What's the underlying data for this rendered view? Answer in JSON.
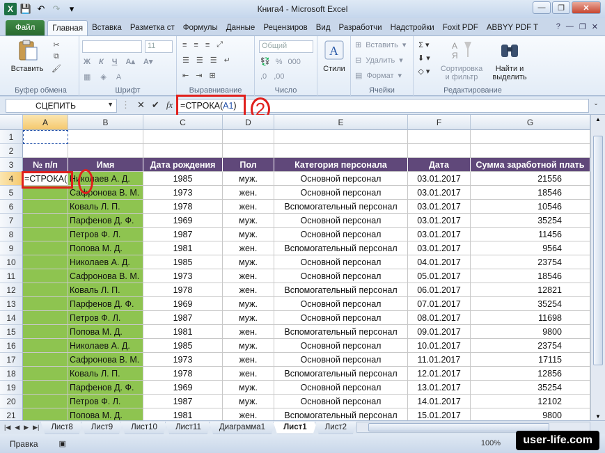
{
  "window": {
    "title": "Книга4  -  Microsoft Excel"
  },
  "tabs": [
    "Файл",
    "Главная",
    "Вставка",
    "Разметка ст",
    "Формулы",
    "Данные",
    "Рецензиров",
    "Вид",
    "Разработчи",
    "Надстройки",
    "Foxit PDF",
    "ABBYY PDF T"
  ],
  "ribbon": {
    "clipboard": {
      "paste": "Вставить",
      "label": "Буфер обмена"
    },
    "font": {
      "size": "11",
      "label": "Шрифт",
      "bold": "Ж",
      "italic": "К",
      "underline": "Ч"
    },
    "alignment": {
      "label": "Выравнивание"
    },
    "number": {
      "format": "Общий",
      "label": "Число"
    },
    "styles": {
      "label": "Стили"
    },
    "cells": {
      "insert": "Вставить",
      "delete": "Удалить",
      "format": "Формат",
      "label": "Ячейки"
    },
    "editing": {
      "sort": "Сортировка",
      "sort2": "и фильтр",
      "find": "Найти и",
      "find2": "выделить",
      "label": "Редактирование"
    }
  },
  "formula_bar": {
    "name_box": "СЦЕПИТЬ",
    "formula_prefix": "=СТРОКА(",
    "formula_ref": "A1",
    "formula_suffix": ")",
    "fx": "fx"
  },
  "annotation": {
    "number": "2"
  },
  "columns": [
    "A",
    "B",
    "C",
    "D",
    "E",
    "F",
    "G"
  ],
  "row_numbers": [
    "1",
    "2",
    "3",
    "4",
    "5",
    "6",
    "7",
    "8",
    "9",
    "10",
    "11",
    "12",
    "13",
    "14",
    "15",
    "16",
    "17",
    "18",
    "19",
    "20",
    "21"
  ],
  "table": {
    "headers": [
      "№ п/п",
      "Имя",
      "Дата рождения",
      "Пол",
      "Категория персонала",
      "Дата",
      "Сумма заработной плать"
    ],
    "editing_cell": "=СТРОКА(",
    "rows": [
      [
        "Николаев А. Д.",
        "1985",
        "муж.",
        "Основной персонал",
        "03.01.2017",
        "21556"
      ],
      [
        "Сафронова В. М.",
        "1973",
        "жен.",
        "Основной персонал",
        "03.01.2017",
        "18546"
      ],
      [
        "Коваль Л. П.",
        "1978",
        "жен.",
        "Вспомогательный персонал",
        "03.01.2017",
        "10546"
      ],
      [
        "Парфенов Д. Ф.",
        "1969",
        "муж.",
        "Основной персонал",
        "03.01.2017",
        "35254"
      ],
      [
        "Петров Ф. Л.",
        "1987",
        "муж.",
        "Основной персонал",
        "03.01.2017",
        "11456"
      ],
      [
        "Попова М. Д.",
        "1981",
        "жен.",
        "Вспомогательный персонал",
        "03.01.2017",
        "9564"
      ],
      [
        "Николаев А. Д.",
        "1985",
        "муж.",
        "Основной персонал",
        "04.01.2017",
        "23754"
      ],
      [
        "Сафронова В. М.",
        "1973",
        "жен.",
        "Основной персонал",
        "05.01.2017",
        "18546"
      ],
      [
        "Коваль Л. П.",
        "1978",
        "жен.",
        "Вспомогательный персонал",
        "06.01.2017",
        "12821"
      ],
      [
        "Парфенов Д. Ф.",
        "1969",
        "муж.",
        "Основной персонал",
        "07.01.2017",
        "35254"
      ],
      [
        "Петров Ф. Л.",
        "1987",
        "муж.",
        "Основной персонал",
        "08.01.2017",
        "11698"
      ],
      [
        "Попова М. Д.",
        "1981",
        "жен.",
        "Вспомогательный персонал",
        "09.01.2017",
        "9800"
      ],
      [
        "Николаев А. Д.",
        "1985",
        "муж.",
        "Основной персонал",
        "10.01.2017",
        "23754"
      ],
      [
        "Сафронова В. М.",
        "1973",
        "жен.",
        "Основной персонал",
        "11.01.2017",
        "17115"
      ],
      [
        "Коваль Л. П.",
        "1978",
        "жен.",
        "Вспомогательный персонал",
        "12.01.2017",
        "12856"
      ],
      [
        "Парфенов Д. Ф.",
        "1969",
        "муж.",
        "Основной персонал",
        "13.01.2017",
        "35254"
      ],
      [
        "Петров Ф. Л.",
        "1987",
        "муж.",
        "Основной персонал",
        "14.01.2017",
        "12102"
      ],
      [
        "Попова М. Д.",
        "1981",
        "жен.",
        "Вспомогательный персонал",
        "15.01.2017",
        "9800"
      ]
    ]
  },
  "sheets": [
    "Лист8",
    "Лист9",
    "Лист10",
    "Лист11",
    "Диаграмма1",
    "Лист1",
    "Лист2"
  ],
  "active_sheet": "Лист1",
  "status": {
    "mode": "Правка",
    "zoom": "100%"
  },
  "watermark": "user-life.com",
  "colors": {
    "header_purple": "#60487a",
    "green_fill": "#8ec450",
    "annotation_red": "#e0201c"
  }
}
